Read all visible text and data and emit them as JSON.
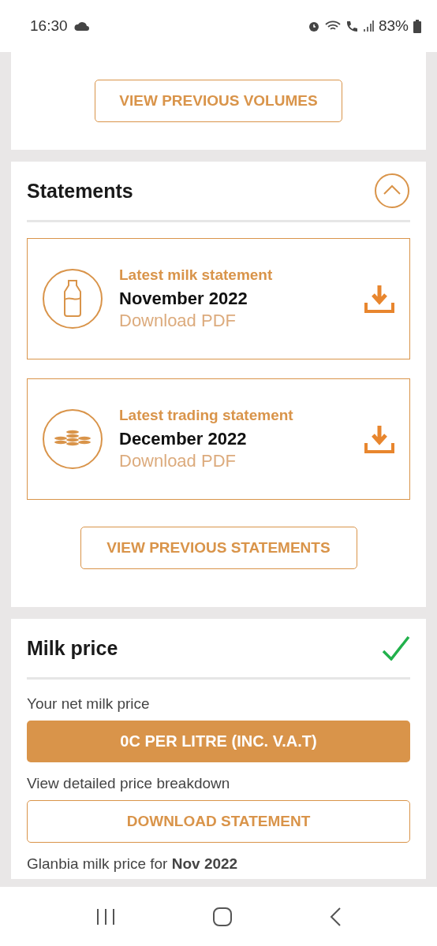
{
  "status_bar": {
    "time": "16:30",
    "battery": "83%"
  },
  "volumes": {
    "button": "VIEW PREVIOUS VOLUMES"
  },
  "statements": {
    "title": "Statements",
    "expanded": true,
    "items": [
      {
        "kind": "milk",
        "label": "Latest milk statement",
        "period": "November 2022",
        "link": "Download PDF"
      },
      {
        "kind": "trading",
        "label": "Latest trading statement",
        "period": "December 2022",
        "link": "Download PDF"
      }
    ],
    "button": "VIEW PREVIOUS STATEMENTS"
  },
  "milk_price": {
    "title": "Milk price",
    "net_label": "Your net milk price",
    "net_value": "0C PER LITRE (INC. V.A.T)",
    "breakdown_label": "View detailed price breakdown",
    "button": "DOWNLOAD STATEMENT",
    "glanbia_label": "Glanbia milk price for **Nov 2022**"
  }
}
